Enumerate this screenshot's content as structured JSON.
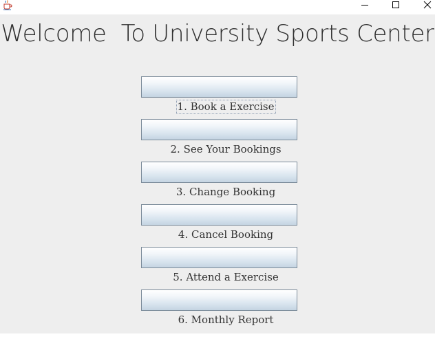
{
  "window": {
    "icon": "java-coffee-cup-icon",
    "controls": [
      "minimize-icon",
      "maximize-icon",
      "close-icon"
    ]
  },
  "main": {
    "title": "Welcome  To University Sports Center",
    "menu": [
      {
        "label": "1. Book a Exercise",
        "focused": true
      },
      {
        "label": "2. See Your Bookings",
        "focused": false
      },
      {
        "label": "3. Change Booking",
        "focused": false
      },
      {
        "label": "4. Cancel Booking",
        "focused": false
      },
      {
        "label": "5. Attend a Exercise",
        "focused": false
      },
      {
        "label": "6. Monthly Report",
        "focused": false
      }
    ]
  },
  "colors": {
    "background": "#eeeeee",
    "titlebar": "#ffffff",
    "button_border": "#7a8a99",
    "button_gradient_top": "#ffffff",
    "button_gradient_bottom": "#c4d4e2",
    "text": "#333333"
  }
}
